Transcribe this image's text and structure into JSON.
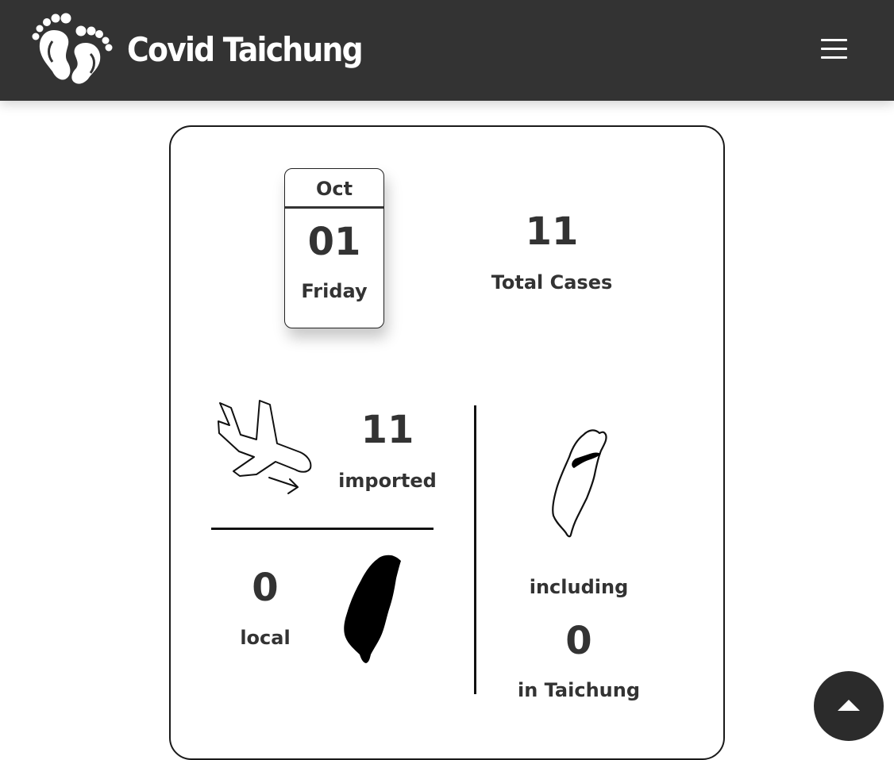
{
  "navbar": {
    "brand_title": "Covid Taichung",
    "logo_icon": "baby-feet-icon",
    "menu_icon": "hamburger-menu-icon"
  },
  "calendar": {
    "month": "Oct",
    "day": "01",
    "weekday": "Friday"
  },
  "stats": {
    "total": {
      "value": "11",
      "label": "Total Cases"
    },
    "imported": {
      "value": "11",
      "label": "imported",
      "icon": "plane-landing-icon"
    },
    "local": {
      "value": "0",
      "label": "local",
      "icon": "taiwan-map-icon"
    },
    "taichung": {
      "prefix": "including",
      "value": "0",
      "label": "in Taichung",
      "icon": "taiwan-taichung-map-icon"
    }
  },
  "scroll_top": {
    "icon": "arrow-up-icon"
  },
  "colors": {
    "navbar_bg": "#333333",
    "text": "#333333",
    "card_border": "#1a1a1a",
    "scroll_button": "#2b2b2b"
  }
}
